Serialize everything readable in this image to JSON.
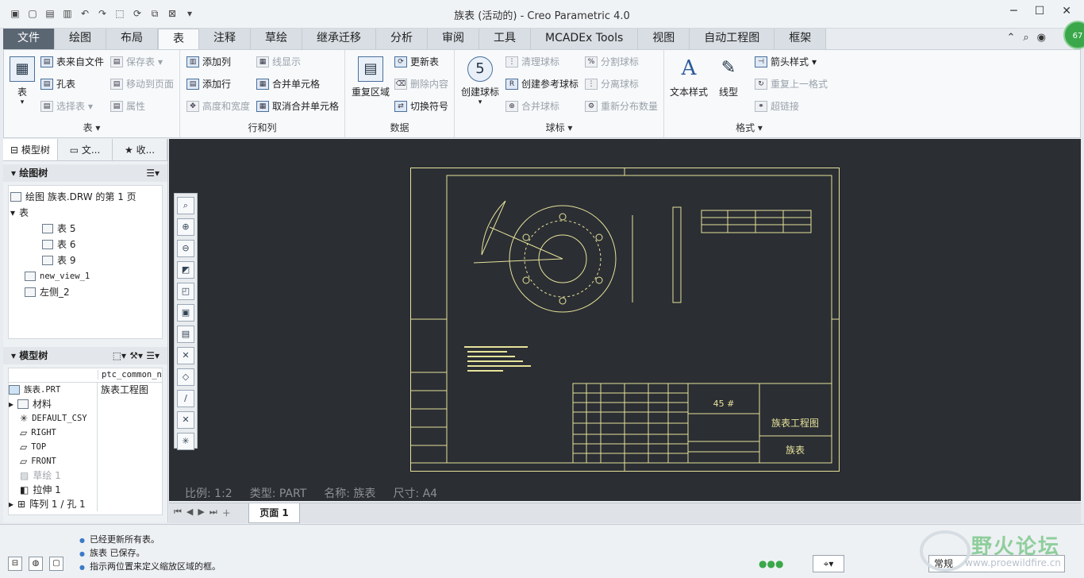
{
  "window": {
    "title": "族表 (活动的) - Creo Parametric 4.0",
    "min": "─",
    "max": "☐",
    "close": "✕"
  },
  "tabs": [
    "文件",
    "绘图",
    "布局",
    "表",
    "注释",
    "草绘",
    "继承迁移",
    "分析",
    "审阅",
    "工具",
    "MCADEx Tools",
    "视图",
    "自动工程图",
    "框架"
  ],
  "avatar": "67",
  "ribbon": {
    "table_group": {
      "label": "表 ▾",
      "big": "表",
      "items": [
        "表来自文件",
        "孔表",
        "选择表",
        "保存表",
        "移动到页面",
        "属性"
      ]
    },
    "rowcol_group": {
      "label": "行和列",
      "items": [
        "添加列",
        "添加行",
        "高度和宽度",
        "线显示",
        "合并单元格",
        "取消合并单元格"
      ]
    },
    "data_group": {
      "label": "数据",
      "big": "重复区域",
      "items": [
        "更新表",
        "删除内容",
        "切换符号"
      ]
    },
    "balloon_group": {
      "label": "球标 ▾",
      "big": "创建球标",
      "items": [
        "清理球标",
        "创建参考球标",
        "合并球标",
        "分割球标",
        "分离球标",
        "重新分布数量"
      ]
    },
    "format_group": {
      "label": "格式 ▾",
      "big1": "文本样式",
      "big2": "线型",
      "items": [
        "箭头样式",
        "重复上一格式",
        "超链接"
      ]
    }
  },
  "panel": {
    "tabs": [
      "模型树",
      "文...",
      "收..."
    ],
    "drawing_tree": {
      "header": "绘图树",
      "root": "绘图 族表.DRW 的第 1 页",
      "group": "表",
      "tables": [
        "表 5",
        "表 6",
        "表 9"
      ],
      "views": [
        "new_view_1",
        "左侧_2"
      ]
    },
    "model_tree": {
      "header": "模型树",
      "col": "ptc_common_na",
      "rows": [
        {
          "name": "族表.PRT",
          "val": "族表工程图"
        },
        {
          "name": "材料",
          "val": ""
        },
        {
          "name": "DEFAULT_CSY",
          "val": ""
        },
        {
          "name": "RIGHT",
          "val": ""
        },
        {
          "name": "TOP",
          "val": ""
        },
        {
          "name": "FRONT",
          "val": ""
        },
        {
          "name": "草绘 1",
          "val": ""
        },
        {
          "name": "拉伸 1",
          "val": ""
        },
        {
          "name": "阵列 1 / 孔 1",
          "val": ""
        }
      ]
    }
  },
  "drawing": {
    "material": "45 #",
    "title": "族表工程图",
    "part": "族表"
  },
  "canvas_info": {
    "scale": "比例: 1:2",
    "type": "类型: PART",
    "name": "名称: 族表",
    "size": "尺寸: A4"
  },
  "page_tab": "页面 1",
  "status": {
    "messages": [
      "已经更新所有表。",
      "族表 已保存。",
      "指示两位置来定义缩放区域的框。"
    ],
    "filter": "常规"
  },
  "watermark": {
    "text": "野火论坛",
    "url": "www.proewildfire.cn"
  }
}
